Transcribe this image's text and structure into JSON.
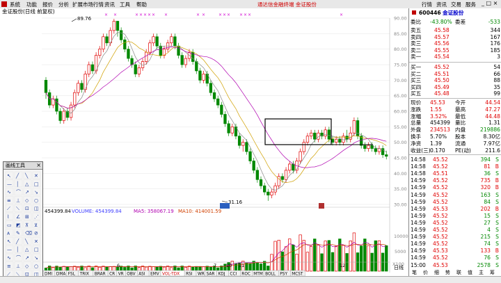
{
  "menu": {
    "items": [
      "系统",
      "功能",
      "报价",
      "分析",
      "扩展市场行情",
      "资讯",
      "工具",
      "帮助"
    ],
    "center_title": "通达信金融终端  金证股份",
    "right_items": [
      "行情",
      "资讯",
      "交易",
      "服务"
    ]
  },
  "chart": {
    "title": "金证股份(日线 前复权)",
    "high_label": "89.76",
    "low_label": "31.16",
    "price_ticks": [
      "90.00",
      "85.00",
      "80.00",
      "75.00",
      "70.00",
      "65.00",
      "60.00",
      "55.00",
      "50.00",
      "45.00",
      "40.00",
      "35.00",
      "30.00"
    ],
    "volume_legend": {
      "total": "454399.84",
      "vol": "VOLUME: 454399.84",
      "ma5": "MA5: 358067.19",
      "ma10": "MA10: 414001.59"
    },
    "vol_ticks": [
      "10000",
      "5000",
      "X100"
    ],
    "date_labels": [
      "6",
      "7",
      "10",
      "11",
      "12"
    ],
    "indicator_tabs": [
      "DMI",
      "DMA",
      "FSL",
      "TRIX",
      "BRAR",
      "CR",
      "VR",
      "OBV",
      "ASI",
      "EMV",
      "VOL-TDX",
      "RSI",
      "WR",
      "SAR",
      "KDJ",
      "CCI",
      "ROC",
      "MTM",
      "BOLL",
      "PSY",
      "MCST"
    ],
    "right_axis_label": "日线"
  },
  "quote": {
    "code": "600446",
    "name": "金证股份",
    "weibi_label": "委比",
    "weibi": "-43.80%",
    "weicha_label": "委差",
    "weicha": "-533",
    "sells": [
      {
        "label": "卖五",
        "price": "45.58",
        "vol": "344"
      },
      {
        "label": "卖四",
        "price": "45.57",
        "vol": "167"
      },
      {
        "label": "卖三",
        "price": "45.56",
        "vol": "176"
      },
      {
        "label": "卖二",
        "price": "45.55",
        "vol": "185"
      },
      {
        "label": "卖一",
        "price": "45.54",
        "vol": "3"
      }
    ],
    "buys": [
      {
        "label": "买一",
        "price": "45.52",
        "vol": "54"
      },
      {
        "label": "买二",
        "price": "45.51",
        "vol": "66"
      },
      {
        "label": "买三",
        "price": "45.50",
        "vol": "88"
      },
      {
        "label": "买四",
        "price": "45.49",
        "vol": "35"
      },
      {
        "label": "买五",
        "price": "45.48",
        "vol": "99"
      }
    ],
    "stats": [
      {
        "l1": "现价",
        "v1": "45.53",
        "l2": "今开",
        "v2": "44.54"
      },
      {
        "l1": "涨跌",
        "v1": "1.55",
        "l2": "最高",
        "v2": "47.27"
      },
      {
        "l1": "涨幅",
        "v1": "3.52%",
        "l2": "最低",
        "v2": "44.48"
      },
      {
        "l1": "总量",
        "v1": "454399",
        "l2": "量比",
        "v2": "1.31"
      },
      {
        "l1": "外盘",
        "v1": "234513",
        "l2": "内盘",
        "v2": "219886"
      },
      {
        "l1": "换手",
        "v1": "5.70%",
        "l2": "股本",
        "v2": "8.30亿"
      },
      {
        "l1": "净资",
        "v1": "1.39",
        "l2": "流通",
        "v2": "7.97亿"
      },
      {
        "l1": "收益(三)",
        "v1": "0.170",
        "l2": "PE(动)",
        "v2": "211.6"
      }
    ],
    "ticks": [
      {
        "t": "14:58",
        "p": "45.52",
        "v": "394",
        "s": "S"
      },
      {
        "t": "14:58",
        "p": "45.52",
        "v": "81",
        "s": "B"
      },
      {
        "t": "14:58",
        "p": "45.51",
        "v": "36",
        "s": "S"
      },
      {
        "t": "14:59",
        "p": "45.52",
        "v": "735",
        "s": "B"
      },
      {
        "t": "14:59",
        "p": "45.52",
        "v": "320",
        "s": "B"
      },
      {
        "t": "14:59",
        "p": "45.52",
        "v": "163",
        "s": "S"
      },
      {
        "t": "14:59",
        "p": "45.52",
        "v": "84",
        "s": "S"
      },
      {
        "t": "14:59",
        "p": "45.53",
        "v": "202",
        "s": "B"
      },
      {
        "t": "14:59",
        "p": "45.52",
        "v": "15",
        "s": "S"
      },
      {
        "t": "14:59",
        "p": "45.52",
        "v": "27",
        "s": "S"
      },
      {
        "t": "14:59",
        "p": "45.52",
        "v": "4",
        "s": "S"
      },
      {
        "t": "14:59",
        "p": "45.52",
        "v": "215",
        "s": "S"
      },
      {
        "t": "14:59",
        "p": "45.52",
        "v": "74",
        "s": "S"
      },
      {
        "t": "14:59",
        "p": "45.53",
        "v": "133",
        "s": "B"
      },
      {
        "t": "14:59",
        "p": "45.52",
        "v": "76",
        "s": "S"
      },
      {
        "t": "15:00",
        "p": "45.53",
        "v": "2578",
        "s": "S"
      }
    ],
    "footer_tabs": [
      "笔",
      "价",
      "细",
      "势",
      "联",
      "值",
      "主",
      "筹"
    ]
  },
  "draw_tools": {
    "title": "画线工具",
    "close": "×"
  }
}
